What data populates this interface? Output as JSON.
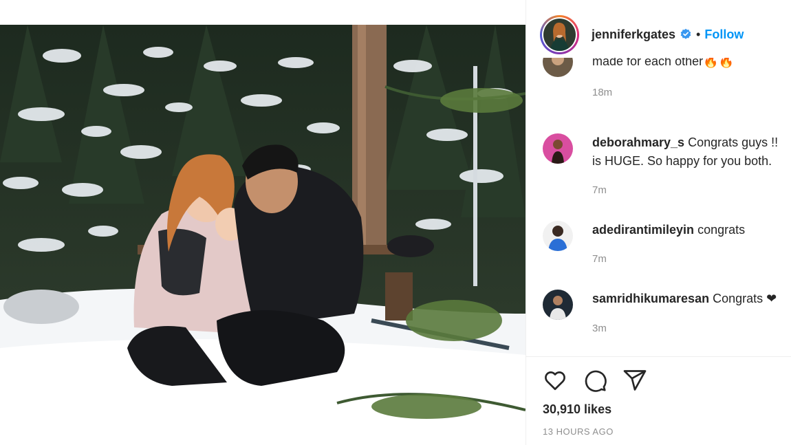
{
  "post": {
    "photo_alt": "",
    "author": {
      "username": "jenniferkgates",
      "separator": "•",
      "follow_label": "Follow"
    },
    "comments": [
      {
        "username": "",
        "text": "made for each other🔥🔥",
        "time": "18m"
      },
      {
        "username": "deborahmary_s",
        "text": "Congrats guys !! is HUGE. So happy for you both.",
        "line1": "Congrats guys !!",
        "line2": "is HUGE. So happy for you both.",
        "time": "7m"
      },
      {
        "username": "adedirantimileyin",
        "text": "congrats",
        "time": "7m"
      },
      {
        "username": "samridhikumaresan",
        "text": "Congrats ❤",
        "time": "3m"
      }
    ],
    "likes": "30,910 likes",
    "posted": "13 HOURS AGO",
    "icons": [
      "heart-icon",
      "comment-icon",
      "share-icon"
    ],
    "colors": {
      "link": "#0095f6",
      "muted": "#8e8e8e",
      "text": "#262626"
    }
  }
}
